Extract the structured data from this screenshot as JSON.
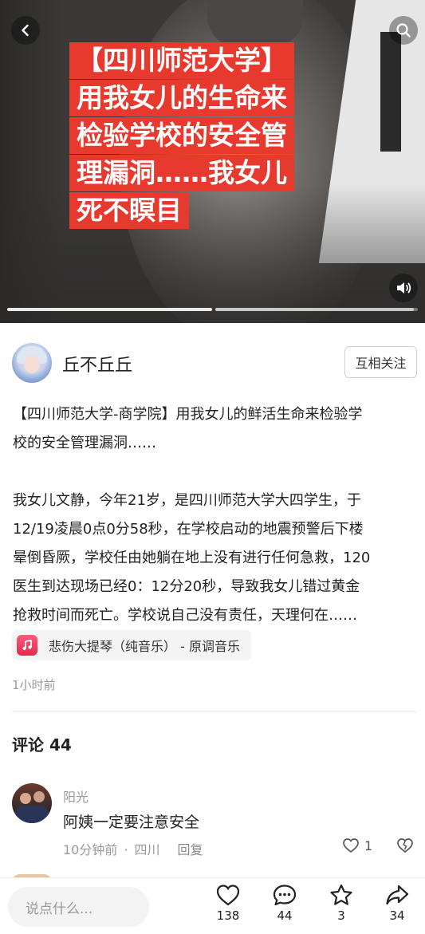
{
  "video": {
    "banner_lines": [
      "【四川师范大学】",
      "用我女儿的生命来",
      "检验学校的安全管",
      "理漏洞……我女儿",
      "死不瞑目"
    ],
    "progress_segments": [
      1.0,
      0.98
    ]
  },
  "author": {
    "name": "丘不丘丘",
    "follow_label": "互相关注"
  },
  "post": {
    "lines": [
      "【四川师范大学-商学院】用我女儿的鲜活生命来检验学",
      "校的安全管理漏洞……",
      "",
      "我女儿文静，今年21岁，是四川师范大学大四学生，于",
      "12/19凌晨0点0分58秒，在学校启动的地震预警后下楼",
      "晕倒昏厥，学校任由她躺在地上没有进行任何急救，120",
      "医生到达现场已经0：12分20秒，导致我女儿错过黄金",
      "抢救时间而死亡。学校说自己没有责任，天理何在……"
    ],
    "music": "悲伤大提琴（纯音乐） - 原调音乐",
    "time": "1小时前"
  },
  "comments": {
    "title": "评论 44",
    "items": [
      {
        "name": "阳光",
        "text": "阿姨一定要注意安全",
        "time": "10分钟前",
        "location": "四川",
        "reply": "回复",
        "likes": "1"
      }
    ]
  },
  "bottom_bar": {
    "input_placeholder": "说点什么...",
    "likes": "138",
    "comments": "44",
    "favorites": "3",
    "shares": "34"
  }
}
